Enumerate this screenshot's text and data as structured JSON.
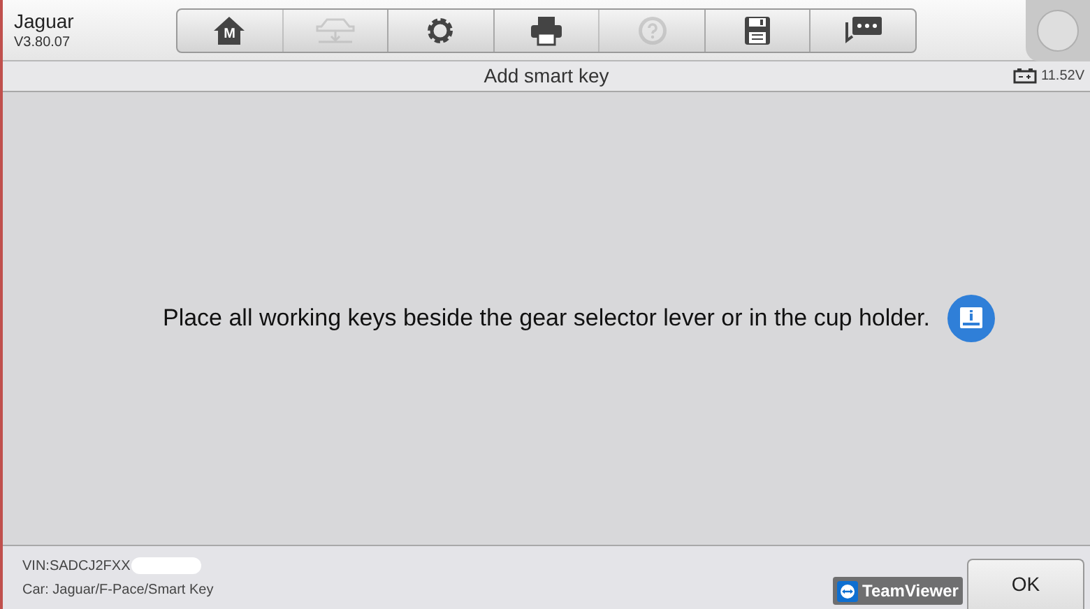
{
  "header": {
    "make": "Jaguar",
    "version": "V3.80.07"
  },
  "toolbar": [
    {
      "kind": "home",
      "label": "M",
      "disabled": false
    },
    {
      "kind": "vehicle",
      "disabled": true
    },
    {
      "kind": "settings",
      "disabled": false
    },
    {
      "kind": "print",
      "disabled": false
    },
    {
      "kind": "help",
      "disabled": true
    },
    {
      "kind": "save",
      "disabled": false
    },
    {
      "kind": "messages",
      "disabled": false
    }
  ],
  "title_bar": {
    "title": "Add smart key",
    "voltage": "11.52V"
  },
  "message": "Place all working keys beside the gear selector lever or in the cup holder.",
  "footer": {
    "vin": "VIN:SADCJ2FXX",
    "car": "Car: Jaguar/F-Pace/Smart Key",
    "button": "OK"
  },
  "overlay": {
    "label": "TeamViewer"
  }
}
